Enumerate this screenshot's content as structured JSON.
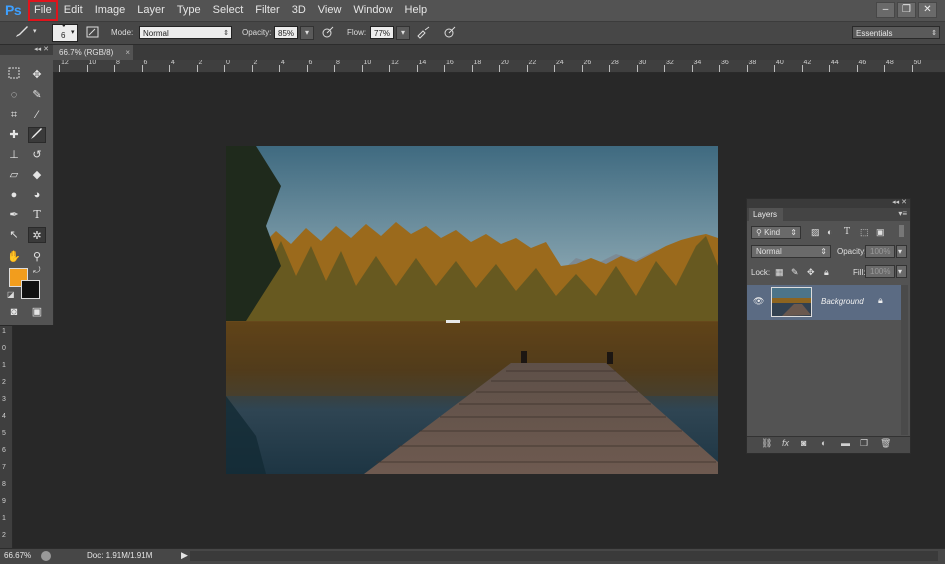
{
  "app": {
    "logo": "Ps"
  },
  "menu": [
    "File",
    "Edit",
    "Image",
    "Layer",
    "Type",
    "Select",
    "Filter",
    "3D",
    "View",
    "Window",
    "Help"
  ],
  "window_controls": [
    "–",
    "❐",
    "✕"
  ],
  "options_bar": {
    "brush_size": "6",
    "mode_label": "Mode:",
    "mode_value": "Normal",
    "opacity_label": "Opacity:",
    "opacity_value": "85%",
    "flow_label": "Flow:",
    "flow_value": "77%",
    "workspace": "Essentials"
  },
  "document_tab": {
    "title": "66.7% (RGB/8)",
    "close": "×"
  },
  "ruler_top_labels": [
    "12",
    "10",
    "8",
    "6",
    "4",
    "2",
    "0",
    "2",
    "4",
    "6",
    "8",
    "10",
    "12",
    "14",
    "16",
    "18",
    "20",
    "22",
    "24",
    "26",
    "28",
    "30",
    "32",
    "34",
    "36",
    "38",
    "40",
    "42",
    "44",
    "46",
    "48",
    "50"
  ],
  "ruler_left_labels": [
    "1",
    "0",
    "1",
    "2",
    "3",
    "4",
    "5",
    "6",
    "7",
    "8",
    "9",
    "1",
    "2"
  ],
  "tools_panel": {
    "collapse": "◂◂  ✕"
  },
  "layers_panel": {
    "header_controls": "◂◂ ✕",
    "tab_label": "Layers",
    "filter_kind": "Kind",
    "blend_mode": "Normal",
    "opacity_label": "Opacity:",
    "opacity_value": "100%",
    "lock_label": "Lock:",
    "fill_label": "Fill:",
    "fill_value": "100%",
    "layer_name": "Background"
  },
  "status_bar": {
    "zoom": "66.67%",
    "doc": "Doc: 1.91M/1.91M",
    "arrow": "▶"
  },
  "icons": {
    "brush": "brush-icon",
    "airbrush": "airbrush-icon",
    "pressure": "pressure-icon",
    "eye": "eye-icon",
    "lock": "lock-icon"
  }
}
